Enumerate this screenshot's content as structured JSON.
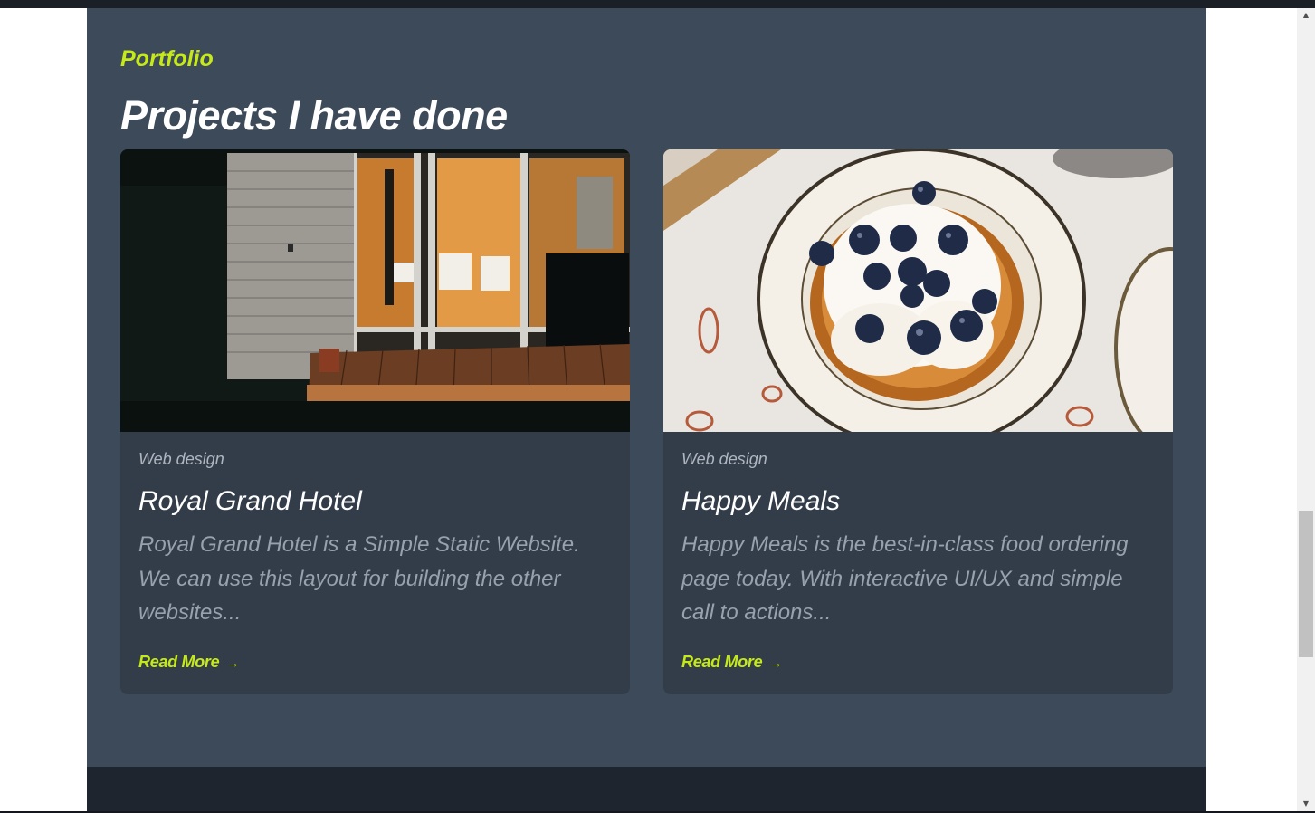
{
  "section": {
    "eyebrow": "Portfolio",
    "title": "Projects I have done"
  },
  "projects": [
    {
      "category": "Web design",
      "title": "Royal Grand Hotel",
      "description": "Royal Grand Hotel is a Simple Static Website. We can use this layout for building the other websites...",
      "read_more": "Read More",
      "image": "night-cabin-porch-photo"
    },
    {
      "category": "Web design",
      "title": "Happy Meals",
      "description": "Happy Meals is the best-in-class food ordering page today. With interactive UI/UX and simple call to actions...",
      "read_more": "Read More",
      "image": "blueberry-pancake-plate-photo"
    }
  ],
  "icons": {
    "read_more": "arrow-right-icon",
    "scroll_up": "scroll-up-arrow-icon",
    "scroll_down": "scroll-down-arrow-icon"
  },
  "colors": {
    "accent": "#c6ea17",
    "section_bg": "#3d4a59",
    "card_bg": "#333d4a",
    "footer_bg": "#1e252f"
  }
}
